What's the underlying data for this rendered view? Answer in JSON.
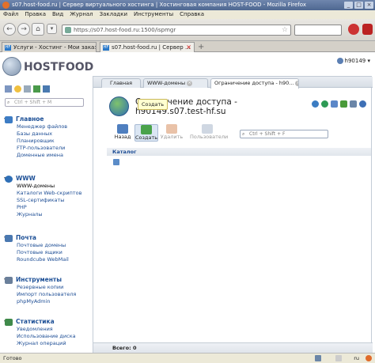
{
  "window": {
    "title": "s07.host-food.ru | Сервер виртуального хостинга | Хостинговая компания HOST-FOOD - Mozilla Firefox",
    "buttons": {
      "min": "_",
      "max": "□",
      "close": "×"
    }
  },
  "menu": [
    "Файл",
    "Правка",
    "Вид",
    "Журнал",
    "Закладки",
    "Инструменты",
    "Справка"
  ],
  "browser": {
    "back": "←",
    "forward": "→",
    "home": "⌂",
    "url": "https://s07.host-food.ru:1500/ispmgr",
    "tabs": [
      {
        "label": "Услуги - Хостинг - Мои заказ...",
        "icon": "HF"
      },
      {
        "label": "s07.host-food.ru | Сервер ...",
        "icon": "HF"
      }
    ]
  },
  "app": {
    "logo_text": "HOSTFOOD",
    "user": "h90149",
    "side_search_placeholder": "Ctrl + Shift + M",
    "sections": [
      {
        "title": "Главное",
        "color": "#3d7cc4",
        "items": [
          "Менеджер файлов",
          "Базы данных",
          "Планировщик",
          "FTP-пользователи",
          "Доменные имена"
        ]
      },
      {
        "title": "WWW",
        "color": "#2f6fb6",
        "items": [
          "WWW-домены",
          "Каталоги Web-скриптов",
          "SSL-сертификаты",
          "PHP",
          "Журналы"
        ]
      },
      {
        "title": "Почта",
        "color": "#4a78b0",
        "items": [
          "Почтовые домены",
          "Почтовые ящики",
          "Roundcube WebMail"
        ]
      },
      {
        "title": "Инструменты",
        "color": "#6a7f9a",
        "items": [
          "Резервные копии",
          "Импорт пользователя",
          "phpMyAdmin"
        ]
      },
      {
        "title": "Статистика",
        "color": "#3f8a4a",
        "items": [
          "Уведомления",
          "Использование диска",
          "Журнал операций"
        ]
      }
    ],
    "content_tabs": [
      "Главная",
      "WWW-домены",
      "Ограничение доступа - h90..."
    ],
    "page_title_line1": "Ограничение доступа -",
    "page_title_line2": "h90149.s07.test-hf.su",
    "tooltip": "Создать",
    "toolbar": [
      "Назад",
      "Создать",
      "Удалить",
      "Пользователи"
    ],
    "search_placeholder": "Ctrl + Shift + F",
    "column_header": "Каталог",
    "footer": "Всего: 0"
  },
  "status": {
    "text": "Готово",
    "lang": "ru"
  }
}
